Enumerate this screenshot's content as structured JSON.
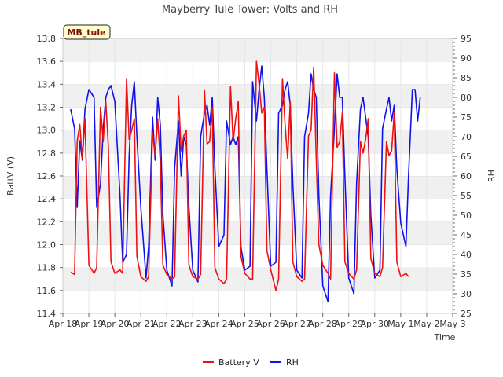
{
  "chart_data": {
    "type": "line",
    "title": "Mayberry Tule Tower: Volts and RH",
    "site_label": "MB_tule",
    "xlabel": "Time",
    "ylabel_left": "BattV (V)",
    "ylabel_right": "RH",
    "ylim_left": [
      11.4,
      13.8
    ],
    "ylim_right": [
      25,
      95
    ],
    "yticks_left": [
      "11.4",
      "11.6",
      "11.8",
      "12.0",
      "12.2",
      "12.4",
      "12.6",
      "12.8",
      "13.0",
      "13.2",
      "13.4",
      "13.6",
      "13.8"
    ],
    "yticks_right": [
      "25",
      "30",
      "35",
      "40",
      "45",
      "50",
      "55",
      "60",
      "65",
      "70",
      "75",
      "80",
      "85",
      "90",
      "95"
    ],
    "x_tick_labels": [
      "Apr 18",
      "Apr 19",
      "Apr 20",
      "Apr 21",
      "Apr 22",
      "Apr 23",
      "Apr 24",
      "Apr 25",
      "Apr 26",
      "Apr 27",
      "Apr 28",
      "Apr 29",
      "Apr 30",
      "May 1",
      "May 2",
      "May 3"
    ],
    "legend_position": "bottom",
    "grid": true,
    "x_days": [
      0.3,
      0.45,
      0.55,
      0.65,
      0.75,
      0.85,
      1.0,
      1.2,
      1.3,
      1.45,
      1.55,
      1.65,
      1.75,
      1.85,
      2.0,
      2.2,
      2.3,
      2.45,
      2.55,
      2.65,
      2.75,
      2.85,
      3.0,
      3.2,
      3.3,
      3.45,
      3.55,
      3.65,
      3.75,
      3.85,
      4.0,
      4.2,
      4.3,
      4.45,
      4.55,
      4.65,
      4.75,
      4.85,
      5.0,
      5.2,
      5.3,
      5.45,
      5.55,
      5.65,
      5.75,
      5.85,
      6.0,
      6.2,
      6.3,
      6.45,
      6.55,
      6.65,
      6.75,
      6.85,
      7.0,
      7.2,
      7.3,
      7.45,
      7.55,
      7.65,
      7.75,
      7.85,
      8.0,
      8.2,
      8.3,
      8.45,
      8.55,
      8.65,
      8.75,
      8.85,
      9.0,
      9.2,
      9.3,
      9.45,
      9.55,
      9.65,
      9.75,
      9.85,
      10.0,
      10.2,
      10.3,
      10.45,
      10.55,
      10.65,
      10.75,
      10.85,
      11.0,
      11.2,
      11.3,
      11.45,
      11.55,
      11.65,
      11.75,
      11.85,
      12.0,
      12.2,
      12.3,
      12.45,
      12.55,
      12.65,
      12.75,
      12.85,
      13.0,
      13.2,
      13.3,
      13.45,
      13.55,
      13.65,
      13.75,
      13.85,
      14.0,
      14.2,
      14.3
    ],
    "series": [
      {
        "name": "Battery V",
        "color": "#ee1111",
        "axis": "left",
        "values": [
          11.76,
          11.74,
          12.9,
          13.05,
          12.75,
          13.1,
          11.82,
          11.75,
          11.8,
          13.2,
          12.9,
          13.25,
          12.85,
          11.85,
          11.75,
          11.78,
          11.75,
          13.45,
          12.92,
          13.0,
          13.1,
          11.9,
          11.72,
          11.68,
          11.72,
          12.98,
          12.78,
          13.1,
          12.72,
          11.82,
          11.74,
          11.7,
          11.72,
          13.3,
          12.82,
          12.95,
          13.0,
          11.82,
          11.72,
          11.7,
          11.74,
          13.35,
          12.88,
          12.9,
          13.2,
          11.8,
          11.7,
          11.66,
          11.7,
          13.38,
          12.9,
          13.1,
          13.25,
          11.9,
          11.75,
          11.7,
          11.7,
          13.6,
          13.4,
          13.15,
          13.2,
          11.95,
          11.78,
          11.6,
          11.7,
          13.45,
          13.05,
          12.75,
          13.25,
          11.85,
          11.72,
          11.68,
          11.7,
          12.95,
          13.0,
          13.55,
          12.75,
          12.0,
          11.82,
          11.75,
          11.7,
          13.5,
          12.85,
          12.9,
          13.15,
          11.85,
          11.75,
          11.7,
          11.78,
          12.9,
          12.8,
          12.92,
          13.1,
          11.88,
          11.75,
          11.72,
          11.8,
          12.9,
          12.78,
          12.82,
          13.15,
          11.85,
          11.72,
          11.75,
          11.72
        ]
      },
      {
        "name": "RH",
        "color": "#1111ee",
        "axis": "right",
        "values": [
          77,
          72,
          52,
          69,
          64,
          77,
          82,
          80,
          52,
          58,
          72,
          80,
          82,
          83,
          79,
          55,
          38,
          40,
          65,
          78,
          84,
          70,
          52,
          34,
          42,
          75,
          64,
          80,
          73,
          50,
          36,
          32,
          62,
          74,
          60,
          70,
          68,
          52,
          36,
          33,
          70,
          76,
          78,
          73,
          80,
          62,
          42,
          45,
          74,
          68,
          70,
          68,
          70,
          42,
          36,
          37,
          84,
          74,
          82,
          88,
          80,
          62,
          37,
          38,
          76,
          78,
          82,
          84,
          78,
          58,
          36,
          34,
          70,
          76,
          86,
          82,
          80,
          55,
          32,
          28,
          55,
          72,
          86,
          80,
          80,
          60,
          34,
          30,
          58,
          77,
          80,
          75,
          70,
          50,
          34,
          36,
          72,
          77,
          80,
          74,
          78,
          62,
          48,
          42,
          60,
          82,
          82,
          74,
          80
        ]
      }
    ]
  }
}
